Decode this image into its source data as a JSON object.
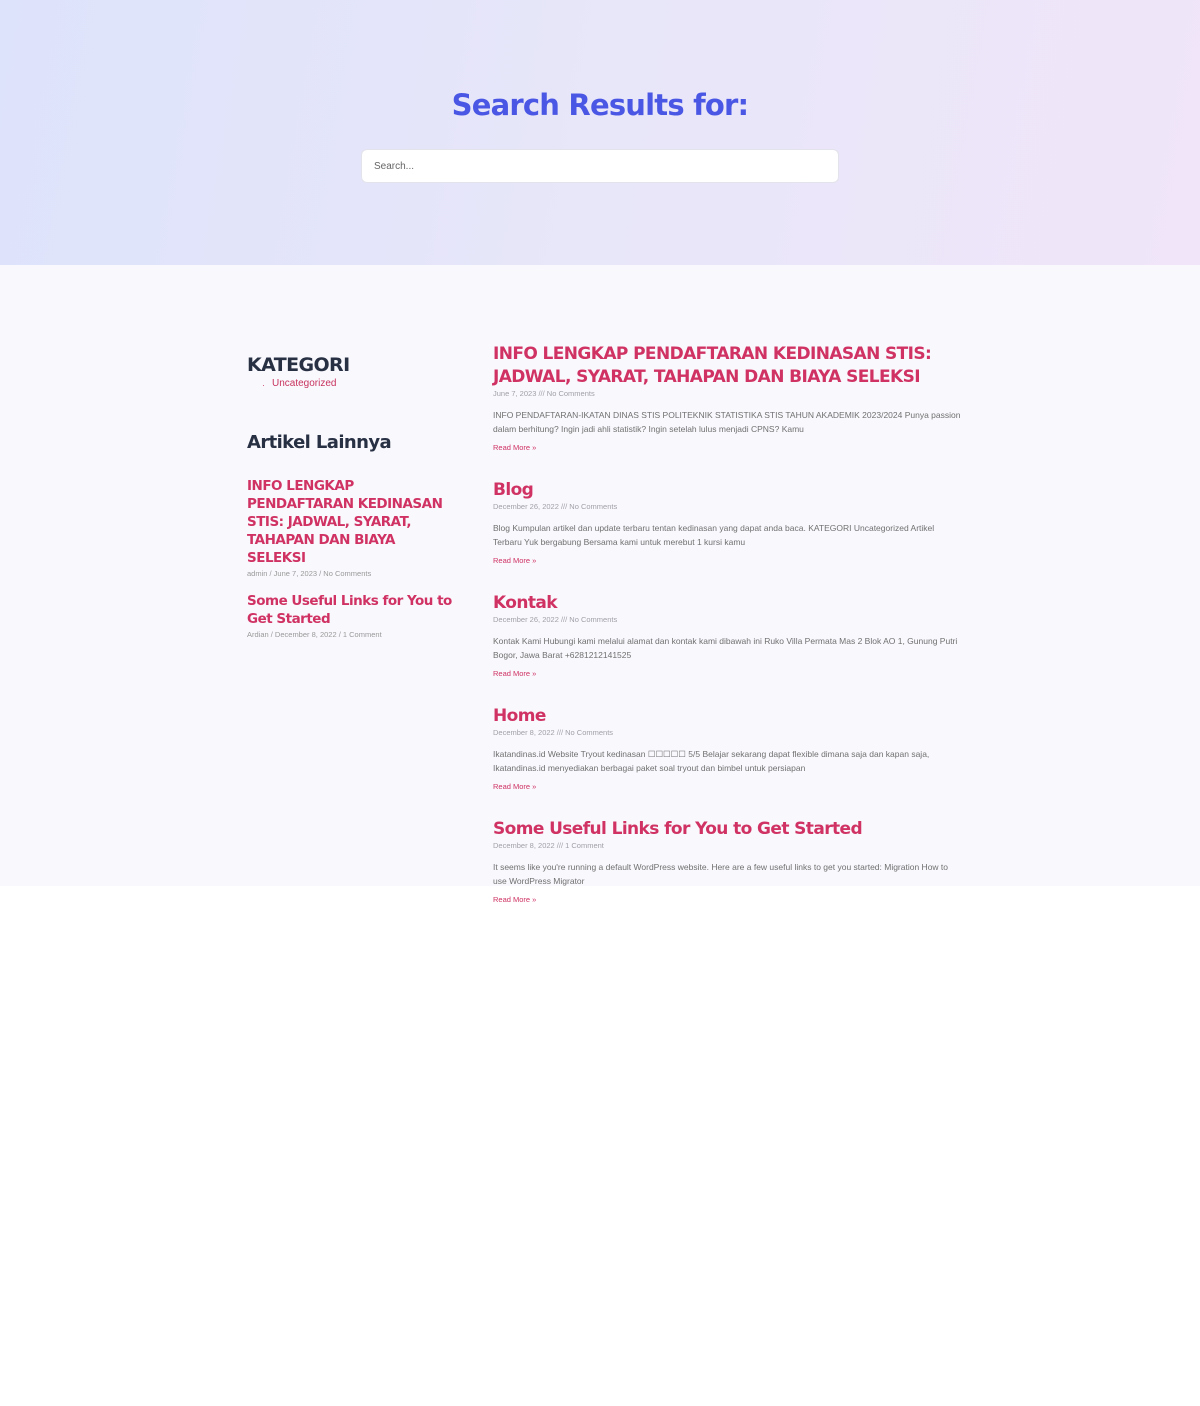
{
  "hero": {
    "title": "Search Results for:",
    "search_placeholder": "Search..."
  },
  "sidebar": {
    "kategori_title": "KATEGORI",
    "categories": [
      "Uncategorized"
    ],
    "artikel_title": "Artikel Lainnya",
    "posts": [
      {
        "title": "INFO LENGKAP PENDAFTARAN KEDINASAN STIS: JADWAL, SYARAT, TAHAPAN DAN BIAYA SELEKSI",
        "meta": "admin / June 7, 2023 / No Comments"
      },
      {
        "title": "Some Useful Links for You to Get Started",
        "meta": "Ardian / December 8, 2022 / 1 Comment"
      }
    ]
  },
  "results": [
    {
      "title": "INFO LENGKAP PENDAFTARAN KEDINASAN STIS: JADWAL, SYARAT, TAHAPAN DAN BIAYA SELEKSI",
      "meta": "June 7, 2023 /// No Comments",
      "excerpt": "INFO PENDAFTARAN-IKATAN DINAS STIS POLITEKNIK STATISTIKA STIS TAHUN AKADEMIK 2023/2024   Punya passion dalam berhitung? Ingin jadi ahli statistik? Ingin setelah lulus menjadi CPNS? Kamu",
      "read_more": "Read More »"
    },
    {
      "title": "Blog",
      "meta": "December 26, 2022 /// No Comments",
      "excerpt": "Blog Kumpulan artikel dan update terbaru tentan kedinasan yang dapat anda baca. KATEGORI Uncategorized Artikel Terbaru Yuk bergabung Bersama kami untuk merebut 1 kursi kamu",
      "read_more": "Read More »"
    },
    {
      "title": "Kontak",
      "meta": "December 26, 2022 /// No Comments",
      "excerpt": "Kontak Kami Hubungi kami melalui alamat dan kontak kami dibawah ini Ruko Villa Permata Mas 2 Blok AO 1, Gunung Putri Bogor, Jawa Barat +6281212141525",
      "read_more": "Read More »"
    },
    {
      "title": "Home",
      "meta": "December 8, 2022 /// No Comments",
      "excerpt": "Ikatandinas.id Website Tryout kedinasan ☐☐☐☐☐ 5/5 Belajar sekarang dapat flexible dimana saja dan kapan saja, Ikatandinas.id menyediakan berbagai paket soal tryout dan bimbel untuk persiapan",
      "read_more": "Read More »"
    },
    {
      "title": "Some Useful Links for You to Get Started",
      "meta": "December 8, 2022 /// 1 Comment",
      "excerpt": "It seems like you're running a default WordPress website. Here are a few useful links to get you started: Migration How to use WordPress Migrator",
      "read_more": "Read More »"
    }
  ],
  "colors": {
    "hero_title": "#4a57e4",
    "link_accent": "#cf3263",
    "heading_dark": "#283044"
  }
}
